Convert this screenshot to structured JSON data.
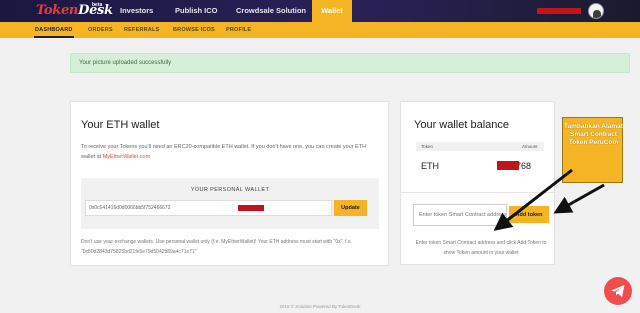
{
  "header": {
    "logo_main": "Token",
    "logo_sub": "Desk",
    "logo_badge": "beta",
    "nav": [
      "Investors",
      "Publish ICO",
      "Crowdsale Solution",
      "Wallet"
    ],
    "active_nav": "Wallet"
  },
  "subnav": [
    "DASHBOARD",
    "ORDERS",
    "REFERRALS",
    "BROWSE ICOS",
    "PROFILE"
  ],
  "alert": {
    "text": "Your picture uploaded successfully"
  },
  "eth_wallet": {
    "title": "Your ETH wallet",
    "intro": "To receive your Tokens you'll need an ERC20-compatible ETH wallet. If you don't have one, you can create your ETH wallet at",
    "link_text": "MyEtherWallet.com",
    "wallet_label": "YOUR PERSONAL WALLET",
    "wallet_value": "0x0c641416d0d0066bb5f752466672",
    "update_label": "Update",
    "note": "Don't use your exchange wallets. Use personal wallet only (f.e. MyEtherWallet)! Your ETH address must start with \"0x\", f.e. \"0x80d2843d75825bd21fe5e79d5042b89a4c71e71\""
  },
  "wallet_balance": {
    "title": "Your wallet balance",
    "col_token": "Token",
    "col_amount": "Amount",
    "row_token": "ETH",
    "row_amount": "768",
    "input_placeholder": "Enter token Smart Contract address",
    "add_label": "Add token",
    "note": "Enter token Smart Contract address and click Add Token to show Token amount in your wallet"
  },
  "annotation": {
    "text": "Tambahkan Alamat Smart Contract Token PeruCoin"
  },
  "footer": {
    "text": "2018 © Solution Powered By TokenDesk"
  },
  "colors": {
    "accent": "#f4b424",
    "topbar": "#1b1740",
    "redaction": "#c0161b"
  },
  "icons": [
    "avatar-icon",
    "telegram-icon",
    "arrow-icon"
  ]
}
